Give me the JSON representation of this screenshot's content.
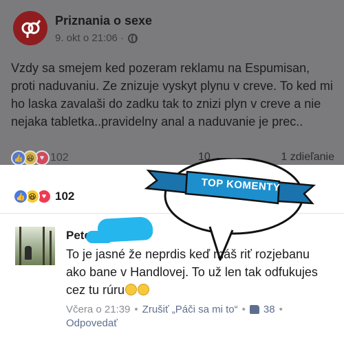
{
  "post": {
    "page_name": "Priznania o sexe",
    "timestamp": "9. okt o 21:06 ·",
    "text": "Vzdy sa smejem ked pozeram reklamu na Espumisan, proti naduvaniu. Ze znizuje vyskyt plynu v creve. To ked mi ho laska zavalaši do zadku tak to znizi plyn v creve a nie nejaka tabletka..pravidelny anal a naduvanie je prec..",
    "reaction_count": "102",
    "comments_count": "10",
    "shares": "1 zdieľanie"
  },
  "sheet": {
    "reaction_count": "102",
    "badge_text": "TOP KOMENTY"
  },
  "comment": {
    "author": "Peter",
    "text": "To je jasné že neprdis keď máš riť rozjebanu ako bane v Handlovej. To už len tak odfukujes cez tu rúru",
    "time": "Včera o 21:39",
    "unlike_label": "Zrušiť „Páči sa mi to“",
    "like_count": "38",
    "reply_label": "Odpovedať"
  },
  "colors": {
    "ribbon": "#1e8fcd",
    "like_blue": "#4a78e6",
    "haha_yellow": "#f7c93a",
    "love_red": "#ef3a53",
    "redaction": "#25b6ee"
  },
  "icons": [
    "page-logo-icon",
    "globe-icon",
    "like-reaction-icon",
    "haha-reaction-icon",
    "love-reaction-icon",
    "thumbs-up-icon",
    "laughing-emoji-icon"
  ]
}
